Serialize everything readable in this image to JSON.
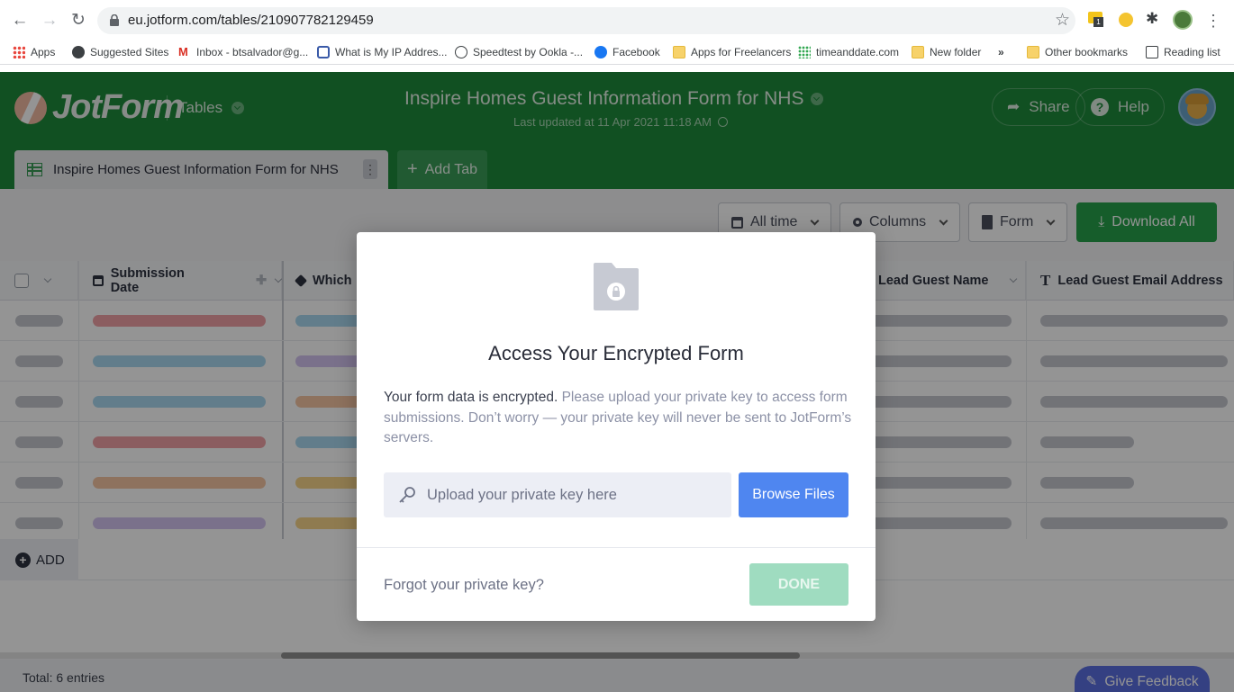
{
  "browser": {
    "url": "eu.jotform.com/tables/210907782129459",
    "bookmarks": [
      {
        "label": "Apps"
      },
      {
        "label": "Suggested Sites"
      },
      {
        "label": "Inbox - btsalvador@g..."
      },
      {
        "label": "What is My IP Addres..."
      },
      {
        "label": "Speedtest by Ookla -..."
      },
      {
        "label": "Facebook"
      },
      {
        "label": "Apps for Freelancers"
      },
      {
        "label": "timeanddate.com"
      },
      {
        "label": "New folder"
      },
      {
        "label": "»"
      },
      {
        "label": "Other bookmarks"
      },
      {
        "label": "Reading list"
      }
    ]
  },
  "header": {
    "logo": "JotForm",
    "section": "Tables",
    "form_title": "Inspire Homes Guest Information Form for NHS",
    "last_updated": "Last updated at 11 Apr 2021 11:18 AM",
    "share_label": "Share",
    "help_label": "Help"
  },
  "tabs": {
    "active_label": "Inspire Homes Guest Information Form for NHS",
    "add_tab_label": "Add Tab"
  },
  "toolbar": {
    "all_time": "All time",
    "columns": "Columns",
    "form": "Form",
    "download_all": "Download All"
  },
  "grid": {
    "columns": [
      "Submission Date",
      "Which",
      "Lead Guest Name",
      "Lead Guest Email Address"
    ],
    "add_label": "ADD",
    "total": "Total: 6 entries"
  },
  "feedback_label": "Give Feedback",
  "modal": {
    "title": "Access Your Encrypted Form",
    "desc_strong": "Your form data is encrypted.",
    "desc_rest": "Please upload your private key to access form submissions. Don’t worry — your private key will never be sent to JotForm’s servers.",
    "upload_placeholder": "Upload your private key here",
    "browse_label": "Browse Files",
    "forgot_label": "Forgot your private key?",
    "done_label": "DONE"
  },
  "colors": {
    "jotform_green": "#1e8a3b",
    "browse_blue": "#4f86f0",
    "done_disabled": "#9fdcc0",
    "feedback_purple": "#5b6ee0"
  }
}
